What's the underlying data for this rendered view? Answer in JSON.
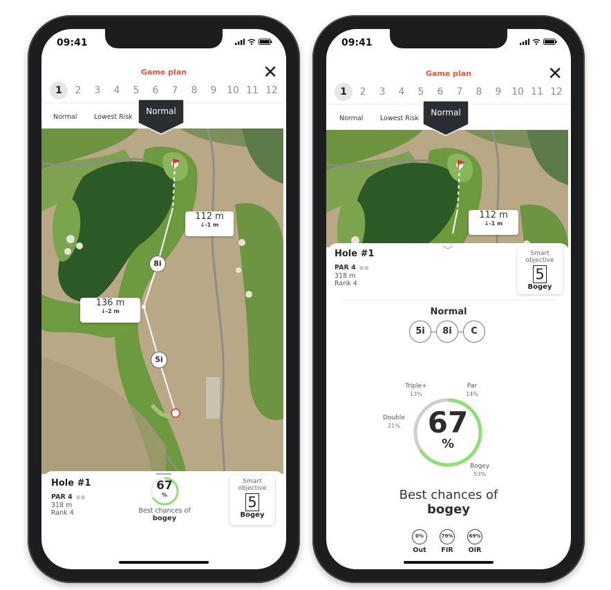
{
  "status": {
    "time": "09:41"
  },
  "header": {
    "title": "Game plan",
    "close_icon": "close-icon"
  },
  "holes": [
    "1",
    "2",
    "3",
    "4",
    "5",
    "6",
    "7",
    "8",
    "9",
    "10",
    "11",
    "12"
  ],
  "active_hole": "1",
  "tabs": {
    "items": [
      "Normal",
      "Lowest Risk"
    ],
    "selected": "Normal"
  },
  "map": {
    "clubs": [
      "8i",
      "5i"
    ],
    "distances": [
      {
        "dist": "112 m",
        "elev": "↓-1 m"
      },
      {
        "dist": "136 m",
        "elev": "↓-2 m"
      }
    ]
  },
  "hole": {
    "name": "Hole #1",
    "par": "PAR 4",
    "length": "318 m",
    "rank": "Rank 4"
  },
  "objective": {
    "label_line1": "Smart",
    "label_line2": "objective",
    "value": "5",
    "result": "Bogey"
  },
  "summary": {
    "percent": "67",
    "percent_value": 67,
    "pct_sign": "%",
    "best_line1": "Best chances of",
    "best_line2": "bogey"
  },
  "plan": {
    "strategy": "Normal",
    "clubs": [
      "5i",
      "8i",
      "C"
    ],
    "distribution": [
      {
        "label": "Par",
        "pct": "14%",
        "value": 14,
        "color": "#8ee06f"
      },
      {
        "label": "Bogey",
        "pct": "53%",
        "value": 53,
        "color": "#8ee06f"
      },
      {
        "label": "Double",
        "pct": "21%",
        "value": 21,
        "color": "#cfcfcf"
      },
      {
        "label": "Triple+",
        "pct": "13%",
        "value": 13,
        "color": "#cfcfcf"
      }
    ],
    "stats": [
      {
        "value": "0%",
        "label": "Out"
      },
      {
        "value": "79%",
        "label": "FIR"
      },
      {
        "value": "69%",
        "label": "OIR"
      }
    ]
  },
  "colors": {
    "accent": "#f0533a",
    "green": "#8ee06f",
    "dark": "#2a2e33"
  }
}
